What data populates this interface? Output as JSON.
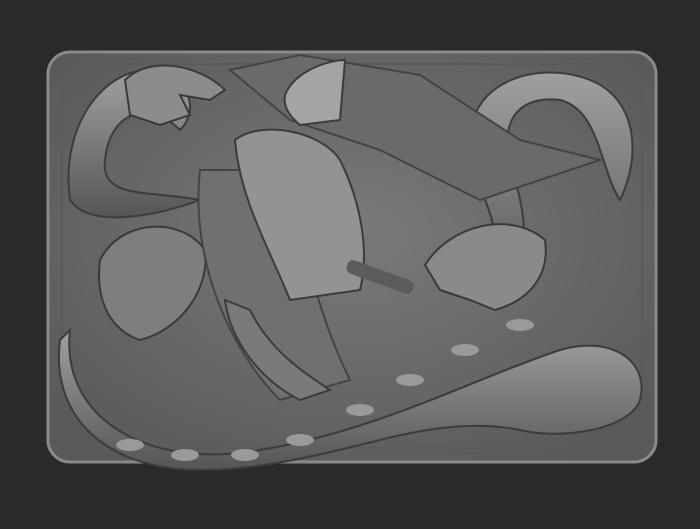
{
  "scene": {
    "subject": "relief-sculpture",
    "colors": {
      "background": "#2a2a2a",
      "plaque": "#6e6e6e",
      "plaque_edge": "#8a8a8a",
      "highlight": "#a8a8a8",
      "shadow": "#3a3a3a"
    }
  }
}
